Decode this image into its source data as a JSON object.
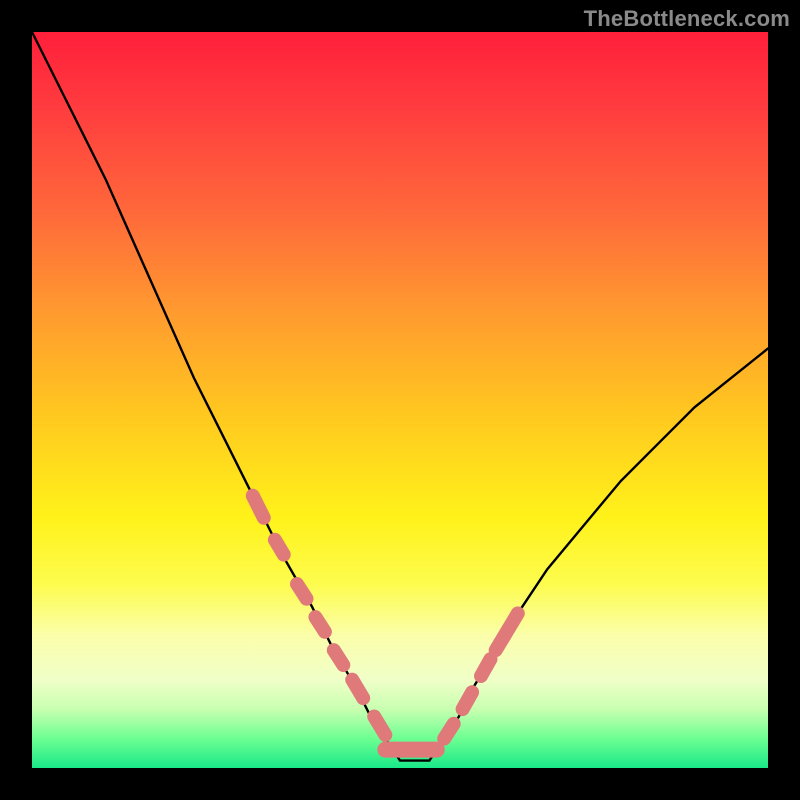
{
  "watermark": "TheBottleneck.com",
  "colors": {
    "frame": "#000000",
    "curve_stroke": "#000000",
    "segment_stroke": "#e07a7a",
    "gradient_stops": [
      "#ff1f3a",
      "#ff3b3f",
      "#ff6a3a",
      "#ff9a2f",
      "#ffc81f",
      "#fff21a",
      "#fdfc4e",
      "#fbfeaa",
      "#f0ffc8",
      "#c8ffb0",
      "#6dff92",
      "#19e888"
    ]
  },
  "chart_data": {
    "type": "line",
    "title": "",
    "xlabel": "",
    "ylabel": "",
    "xlim": [
      0,
      100
    ],
    "ylim": [
      0,
      100
    ],
    "series": [
      {
        "name": "bottleneck-curve",
        "x": [
          0,
          5,
          10,
          14,
          18,
          22,
          26,
          30,
          34,
          38,
          41,
          44,
          46,
          48,
          50,
          54,
          56,
          58,
          60,
          63,
          66,
          70,
          75,
          80,
          85,
          90,
          95,
          100
        ],
        "y": [
          100,
          90,
          80,
          71,
          62,
          53,
          45,
          37,
          29,
          22,
          16,
          11,
          7,
          4,
          1,
          1,
          4,
          7,
          11,
          16,
          21,
          27,
          33,
          39,
          44,
          49,
          53,
          57
        ]
      }
    ],
    "highlight_segments": [
      {
        "name": "left-upper",
        "x": [
          30,
          31.5
        ],
        "y": [
          37,
          34
        ]
      },
      {
        "name": "left-dot-1",
        "x": [
          33,
          34.2
        ],
        "y": [
          31,
          29
        ]
      },
      {
        "name": "left-dot-2",
        "x": [
          36,
          37.3
        ],
        "y": [
          25,
          23
        ]
      },
      {
        "name": "left-dot-3",
        "x": [
          38.5,
          39.8
        ],
        "y": [
          20.5,
          18.5
        ]
      },
      {
        "name": "left-dot-4",
        "x": [
          41,
          42.3
        ],
        "y": [
          16,
          14
        ]
      },
      {
        "name": "left-dot-5",
        "x": [
          43.5,
          45
        ],
        "y": [
          12,
          9.5
        ]
      },
      {
        "name": "left-lower",
        "x": [
          46.5,
          48
        ],
        "y": [
          7,
          4.5
        ]
      },
      {
        "name": "valley-flat",
        "x": [
          48,
          55
        ],
        "y": [
          2.5,
          2.5
        ]
      },
      {
        "name": "right-lower",
        "x": [
          56,
          57.3
        ],
        "y": [
          4,
          6
        ]
      },
      {
        "name": "right-dot-1",
        "x": [
          58.5,
          59.8
        ],
        "y": [
          8,
          10.3
        ]
      },
      {
        "name": "right-dot-2",
        "x": [
          61,
          62.3
        ],
        "y": [
          12.5,
          14.8
        ]
      },
      {
        "name": "right-upper",
        "x": [
          63,
          66
        ],
        "y": [
          16,
          21
        ]
      }
    ]
  }
}
